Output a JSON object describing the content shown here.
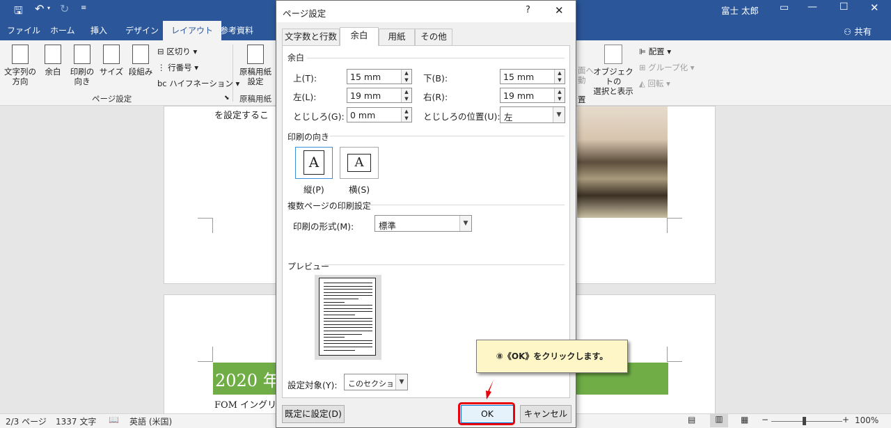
{
  "app": {
    "user": "富士 太郎",
    "share": "共有",
    "quick_access": [
      "save-icon",
      "undo-icon",
      "redo-icon",
      "customize-icon"
    ]
  },
  "ribbon": {
    "tabs": [
      "ファイル",
      "ホーム",
      "挿入",
      "デザイン",
      "レイアウト",
      "参考資料"
    ],
    "active_tab": "レイアウト",
    "buttons": {
      "text_direction": "文字列の\n方向",
      "margins": "余白",
      "orientation": "印刷の\n向き",
      "size": "サイズ",
      "columns": "段組み",
      "breaks": "区切り",
      "line_numbers": "行番号",
      "hyphenation": "ハイフネーション",
      "manuscript": "原稿用紙\n設定",
      "selection_pane": "オブジェクトの\n選択と表示",
      "align": "配置",
      "group": "グループ化",
      "rotate": "回転",
      "partial_left": "面へ\n動",
      "partial_pos": "置"
    },
    "groups": {
      "page_setup": "ページ設定",
      "manuscript": "原稿用紙"
    }
  },
  "document": {
    "line1": "を設定するこ",
    "banner_text": "2020 年",
    "line2": "FOM イングリ",
    "banner_color": "#70ad47"
  },
  "status": {
    "page": "2/3 ページ",
    "words": "1337 文字",
    "language": "英語 (米国)",
    "zoom": "100%"
  },
  "dialog": {
    "title": "ページ設定",
    "help": "?",
    "close": "✕",
    "tabs": [
      "文字数と行数",
      "余白",
      "用紙",
      "その他"
    ],
    "active_tab": "余白",
    "margins_section": "余白",
    "top_label": "上(T):",
    "top_value": "15 mm",
    "bottom_label": "下(B):",
    "bottom_value": "15 mm",
    "left_label": "左(L):",
    "left_value": "19 mm",
    "right_label": "右(R):",
    "right_value": "19 mm",
    "gutter_label": "とじしろ(G):",
    "gutter_value": "0 mm",
    "gutter_pos_label": "とじしろの位置(U):",
    "gutter_pos_value": "左",
    "orientation_section": "印刷の向き",
    "portrait_label": "縦(P)",
    "landscape_label": "横(S)",
    "orient_glyph": "A",
    "multiple_section": "複数ページの印刷設定",
    "multiple_label": "印刷の形式(M):",
    "multiple_value": "標準",
    "preview_section": "プレビュー",
    "apply_label": "設定対象(Y):",
    "apply_value": "このセクション",
    "default_button": "既定に設定(D)",
    "ok_button": "OK",
    "cancel_button": "キャンセル"
  },
  "callout": {
    "text": "⑧《OK》をクリックします。",
    "highlight_color": "#e8000b"
  }
}
